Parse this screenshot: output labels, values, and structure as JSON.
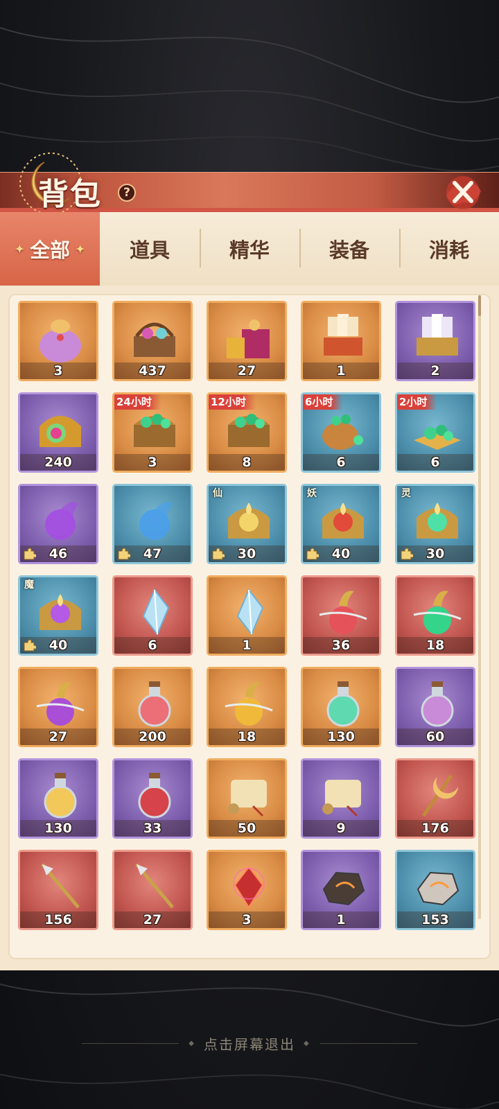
{
  "header": {
    "title": "背包",
    "help_label": "?",
    "close_icon": "close-x-icon"
  },
  "tabs": [
    {
      "label": "全部",
      "active": true
    },
    {
      "label": "道具",
      "active": false
    },
    {
      "label": "精华",
      "active": false
    },
    {
      "label": "装备",
      "active": false
    },
    {
      "label": "消耗",
      "active": false
    }
  ],
  "items": [
    {
      "name": "lucky-bag",
      "count": "3",
      "rarity": "orange",
      "icon": "bag-icon"
    },
    {
      "name": "potion-basket",
      "count": "437",
      "rarity": "orange",
      "icon": "basket-icon"
    },
    {
      "name": "treasure-pack",
      "count": "27",
      "rarity": "orange",
      "icon": "gift-box-icon"
    },
    {
      "name": "card-chest",
      "count": "1",
      "rarity": "orange",
      "icon": "card-chest-icon"
    },
    {
      "name": "card-box",
      "count": "2",
      "rarity": "purple",
      "icon": "card-box-icon"
    },
    {
      "name": "rainbow-chest",
      "count": "240",
      "rarity": "purple",
      "icon": "chest-icon"
    },
    {
      "name": "jade-chest",
      "count": "3",
      "rarity": "orange",
      "badge": "24小时",
      "icon": "jade-chest-icon"
    },
    {
      "name": "jade-chest-open",
      "count": "8",
      "rarity": "orange",
      "badge": "12小时",
      "icon": "jade-chest-icon"
    },
    {
      "name": "jade-sack",
      "count": "6",
      "rarity": "blue",
      "badge": "6小时",
      "icon": "jade-sack-icon"
    },
    {
      "name": "jade-pile",
      "count": "6",
      "rarity": "blue",
      "badge": "2小时",
      "icon": "jade-pile-icon"
    },
    {
      "name": "purple-flame-orb",
      "count": "46",
      "rarity": "purple",
      "fragment": true,
      "icon": "flame-orb-icon"
    },
    {
      "name": "blue-flame-orb",
      "count": "47",
      "rarity": "blue",
      "fragment": true,
      "icon": "flame-orb-icon"
    },
    {
      "name": "immortal-chest",
      "count": "30",
      "rarity": "blue",
      "race": "仙",
      "fragment": true,
      "icon": "race-chest-icon"
    },
    {
      "name": "demon-chest",
      "count": "40",
      "rarity": "blue",
      "race": "妖",
      "fragment": true,
      "icon": "race-chest-icon"
    },
    {
      "name": "spirit-chest",
      "count": "30",
      "rarity": "blue",
      "race": "灵",
      "fragment": true,
      "icon": "race-chest-icon"
    },
    {
      "name": "devil-chest",
      "count": "40",
      "rarity": "blue",
      "race": "魔",
      "fragment": true,
      "icon": "race-chest-icon"
    },
    {
      "name": "ice-crystal-large",
      "count": "6",
      "rarity": "red",
      "icon": "crystal-icon"
    },
    {
      "name": "ice-crystal-small",
      "count": "1",
      "rarity": "orange",
      "icon": "crystal-icon"
    },
    {
      "name": "red-gourd",
      "count": "36",
      "rarity": "red",
      "icon": "gourd-icon"
    },
    {
      "name": "green-gourd",
      "count": "18",
      "rarity": "red",
      "icon": "gourd-icon"
    },
    {
      "name": "purple-gourd",
      "count": "27",
      "rarity": "orange",
      "icon": "gourd-icon"
    },
    {
      "name": "red-potion",
      "count": "200",
      "rarity": "orange",
      "icon": "potion-icon"
    },
    {
      "name": "gold-gourd",
      "count": "18",
      "rarity": "orange",
      "icon": "gourd-icon"
    },
    {
      "name": "green-potion",
      "count": "130",
      "rarity": "orange",
      "icon": "potion-icon"
    },
    {
      "name": "purple-potion",
      "count": "60",
      "rarity": "purple",
      "icon": "potion-icon"
    },
    {
      "name": "yellow-potion",
      "count": "130",
      "rarity": "purple",
      "icon": "potion-icon"
    },
    {
      "name": "crimson-potion",
      "count": "33",
      "rarity": "purple",
      "icon": "potion-icon"
    },
    {
      "name": "gold-scroll",
      "count": "50",
      "rarity": "orange",
      "icon": "scroll-icon"
    },
    {
      "name": "silver-scroll",
      "count": "9",
      "rarity": "purple",
      "icon": "scroll-icon"
    },
    {
      "name": "moon-staff",
      "count": "176",
      "rarity": "red",
      "icon": "staff-icon"
    },
    {
      "name": "golden-spear",
      "count": "156",
      "rarity": "red",
      "icon": "spear-icon"
    },
    {
      "name": "steel-spear",
      "count": "27",
      "rarity": "red",
      "icon": "spear-icon"
    },
    {
      "name": "fire-gem",
      "count": "3",
      "rarity": "orange",
      "icon": "gem-icon"
    },
    {
      "name": "lava-ore",
      "count": "1",
      "rarity": "purple",
      "icon": "ore-icon"
    },
    {
      "name": "stone-ore",
      "count": "153",
      "rarity": "blue",
      "icon": "ore-icon"
    }
  ],
  "footer": {
    "exit_hint": "点击屏幕退出"
  },
  "colors": {
    "accent": "#d76547",
    "orange_frame": "#f0ad5f",
    "purple_frame": "#b295dd",
    "blue_frame": "#8fc6da",
    "red_frame": "#ec9a8c",
    "badge": "#d9413a"
  }
}
